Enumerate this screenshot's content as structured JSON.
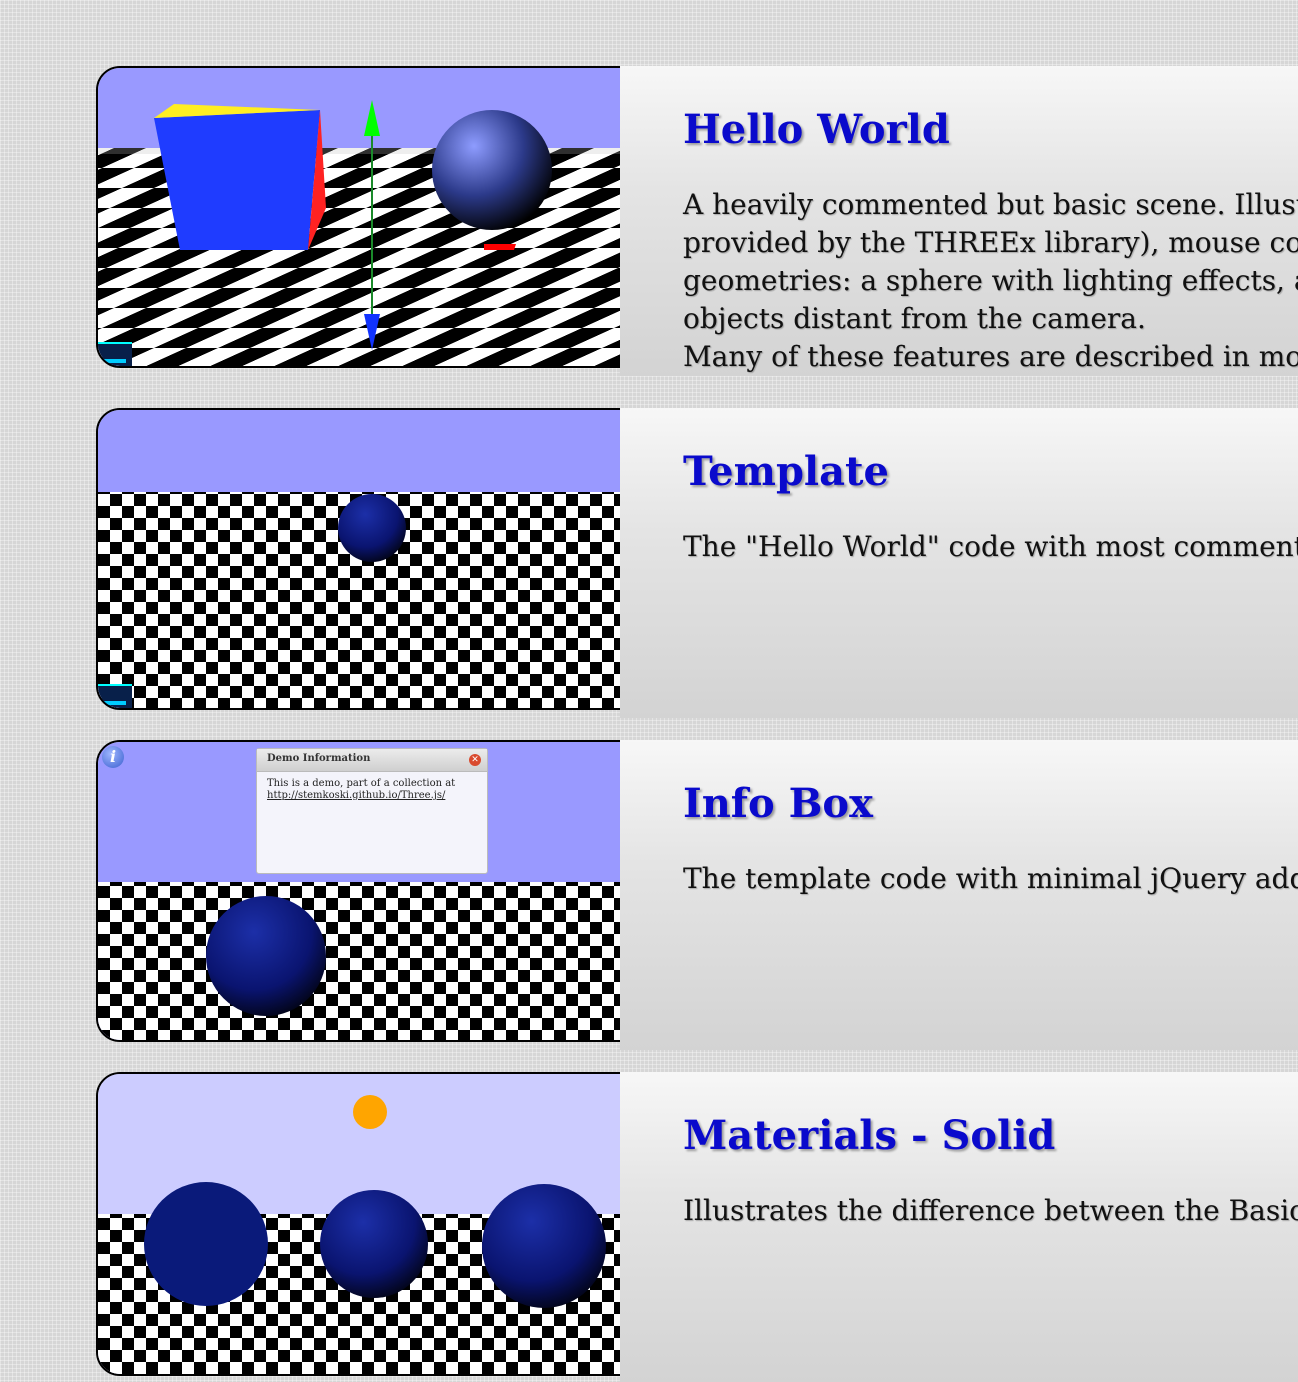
{
  "demos": [
    {
      "title": "Hello World",
      "description": "A heavily commented but basic scene. Illust\nprovided by the THREEx library), mouse co\ngeometries: a sphere with lighting effects, a\nobjects distant from the camera.\nMany of these features are described in mor"
    },
    {
      "title": "Template",
      "description": "The \"Hello World\" code with most comment"
    },
    {
      "title": "Info Box",
      "description": "The template code with minimal jQuery add",
      "infobox": {
        "title": "Demo Information",
        "line1": "This is a demo, part of a collection at",
        "link": "http://stemkoski.github.io/Three.js/"
      }
    },
    {
      "title": "Materials - Solid",
      "description": "Illustrates the difference between the Basic,"
    }
  ],
  "colors": {
    "title": "#0a0acc",
    "sky": "#9999ff",
    "sky_light": "#ccccff",
    "sphere": "#0a1a7a"
  }
}
